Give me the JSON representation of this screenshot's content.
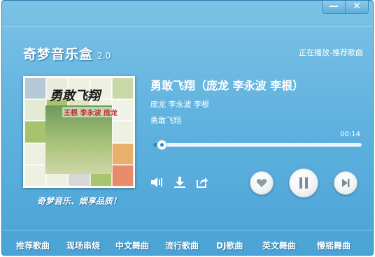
{
  "window": {
    "minimize_label": "—",
    "close_label": "✕"
  },
  "header": {
    "app_name": "奇梦音乐盒",
    "version": "2.0",
    "status": "正在播放-推荐歌曲"
  },
  "cover": {
    "title_text": "勇敢飞翔",
    "names_text": "王根 李永波 庞龙"
  },
  "slogan": "奇梦音乐、娱享品质！",
  "track": {
    "title": "勇敢飞翔（庞龙  李永波  李根）",
    "artist": "庞龙 李永波 李根",
    "album": "勇敢飞翔",
    "elapsed": "00:14",
    "progress_fraction": 0.04
  },
  "icons": {
    "volume": "volume-icon",
    "download": "download-icon",
    "share": "share-icon",
    "favorite": "heart-icon",
    "pause": "pause-icon",
    "next": "next-track-icon"
  },
  "colors": {
    "accent": "#2a88c4",
    "panel": "#61b3df"
  },
  "nav": {
    "items": [
      {
        "label": "推荐歌曲"
      },
      {
        "label": "现场串烧"
      },
      {
        "label": "中文舞曲"
      },
      {
        "label": "流行歌曲"
      },
      {
        "label": "DJ歌曲"
      },
      {
        "label": "英文舞曲"
      },
      {
        "label": "慢摇舞曲"
      }
    ]
  }
}
